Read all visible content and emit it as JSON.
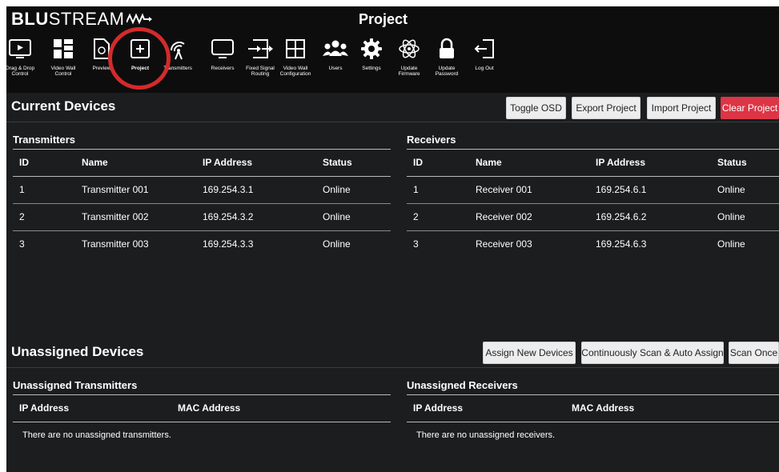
{
  "brand": {
    "bold": "BLU",
    "regular": "STREAM"
  },
  "app_title": "Project",
  "nav": [
    {
      "label": "Drag & Drop\nControl",
      "icon": "monitor-play-icon"
    },
    {
      "label": "Video Wall\nControl",
      "icon": "video-wall-grid-icon"
    },
    {
      "label": "Preview",
      "icon": "document-icon"
    },
    {
      "label": "Project",
      "icon": "plus-square-icon"
    },
    {
      "label": "Transmitters",
      "icon": "antenna-signal-icon"
    },
    {
      "label": "Receivers",
      "icon": "monitor-icon"
    },
    {
      "label": "Fixed Signal\nRouting",
      "icon": "routing-arrows-icon"
    },
    {
      "label": "Video Wall\nConfiguration",
      "icon": "window-grid-icon"
    },
    {
      "label": "Users",
      "icon": "users-icon"
    },
    {
      "label": "Settings",
      "icon": "gear-icon"
    },
    {
      "label": "Update\nFirmware",
      "icon": "atom-icon"
    },
    {
      "label": "Update\nPassword",
      "icon": "lock-icon"
    },
    {
      "label": "Log Out",
      "icon": "logout-icon"
    }
  ],
  "current": {
    "title": "Current Devices",
    "buttons": {
      "toggle_osd": "Toggle OSD",
      "export": "Export Project",
      "import": "Import Project",
      "clear": "Clear Project"
    },
    "transmitters": {
      "title": "Transmitters",
      "headers": [
        "ID",
        "Name",
        "IP Address",
        "Status"
      ],
      "rows": [
        [
          "1",
          "Transmitter 001",
          "169.254.3.1",
          "Online"
        ],
        [
          "2",
          "Transmitter 002",
          "169.254.3.2",
          "Online"
        ],
        [
          "3",
          "Transmitter 003",
          "169.254.3.3",
          "Online"
        ]
      ]
    },
    "receivers": {
      "title": "Receivers",
      "headers": [
        "ID",
        "Name",
        "IP Address",
        "Status"
      ],
      "rows": [
        [
          "1",
          "Receiver 001",
          "169.254.6.1",
          "Online"
        ],
        [
          "2",
          "Receiver 002",
          "169.254.6.2",
          "Online"
        ],
        [
          "3",
          "Receiver 003",
          "169.254.6.3",
          "Online"
        ]
      ]
    }
  },
  "unassigned": {
    "title": "Unassigned Devices",
    "buttons": {
      "assign": "Assign New Devices",
      "scan_auto": "Continuously Scan & Auto Assign",
      "scan_once": "Scan Once"
    },
    "transmitters": {
      "title": "Unassigned Transmitters",
      "headers": [
        "IP Address",
        "MAC Address"
      ],
      "empty": "There are no unassigned transmitters."
    },
    "receivers": {
      "title": "Unassigned Receivers",
      "headers": [
        "IP Address",
        "MAC Address"
      ],
      "empty": "There are no unassigned receivers."
    }
  },
  "colors": {
    "background": "#1c1d1e",
    "header": "#0d0d0e",
    "danger": "#dc3545",
    "highlight_ring": "#d42a2a"
  }
}
